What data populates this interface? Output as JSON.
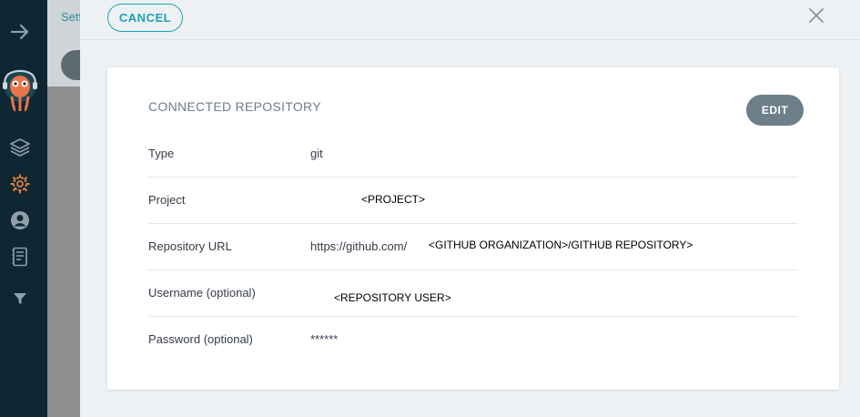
{
  "sidebar": {
    "icons": [
      "arrow-right-icon",
      "argo-avatar-icon",
      "layers-icon",
      "settings-gear-icon",
      "user-icon",
      "docs-icon",
      "filter-icon"
    ]
  },
  "backdrop": {
    "breadcrumb": "Sett"
  },
  "panel": {
    "cancel_label": "CANCEL",
    "card": {
      "title": "CONNECTED REPOSITORY",
      "edit_label": "EDIT",
      "rows": [
        {
          "label": "Type",
          "value": "git"
        },
        {
          "label": "Project",
          "value": "<PROJECT>"
        },
        {
          "label": "Repository URL",
          "value": "https://github.com/",
          "value_extra": "<GITHUB ORGANIZATION>/GITHUB REPOSITORY>"
        },
        {
          "label": "Username (optional)",
          "value": "<REPOSITORY USER>"
        },
        {
          "label": "Password (optional)",
          "value": "******"
        }
      ]
    }
  },
  "colors": {
    "sidebar": "#0f2733",
    "accent": "#1aa3b8",
    "edit_button": "#6d7f8b",
    "settings_icon": "#e0803f"
  }
}
